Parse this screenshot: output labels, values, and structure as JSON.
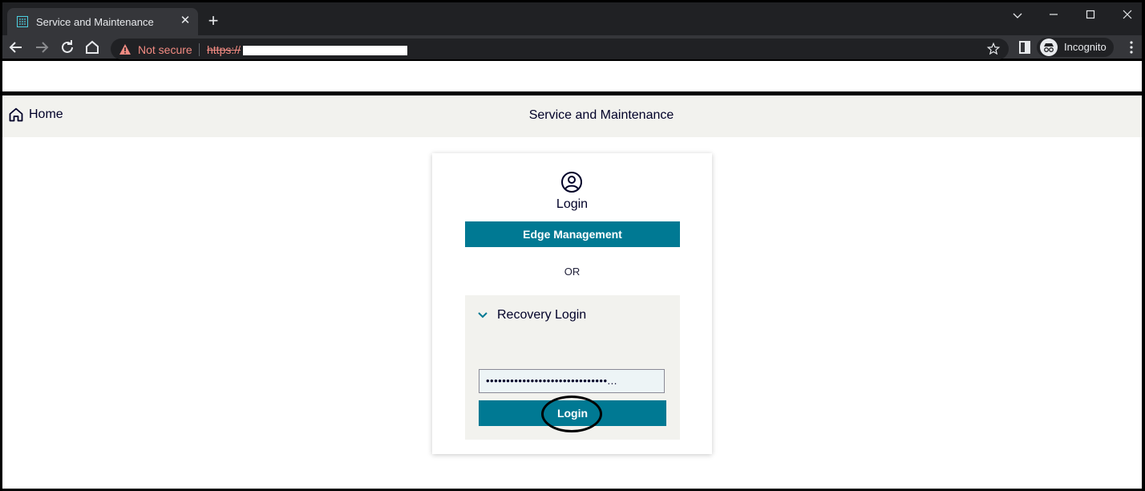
{
  "browser": {
    "tab_title": "Service and Maintenance",
    "security_label": "Not secure",
    "url_scheme": "https://",
    "profile_label": "Incognito"
  },
  "page": {
    "home_label": "Home",
    "title": "Service and Maintenance"
  },
  "login": {
    "heading": "Login",
    "edge_button": "Edge Management",
    "or_text": "OR",
    "recovery_label": "Recovery Login",
    "password_value": "••••••••••••••••••••••••••••••...",
    "login_button": "Login"
  },
  "colors": {
    "accent": "#007993",
    "header_bg": "#f2f2ee",
    "text_dark": "#000028"
  }
}
